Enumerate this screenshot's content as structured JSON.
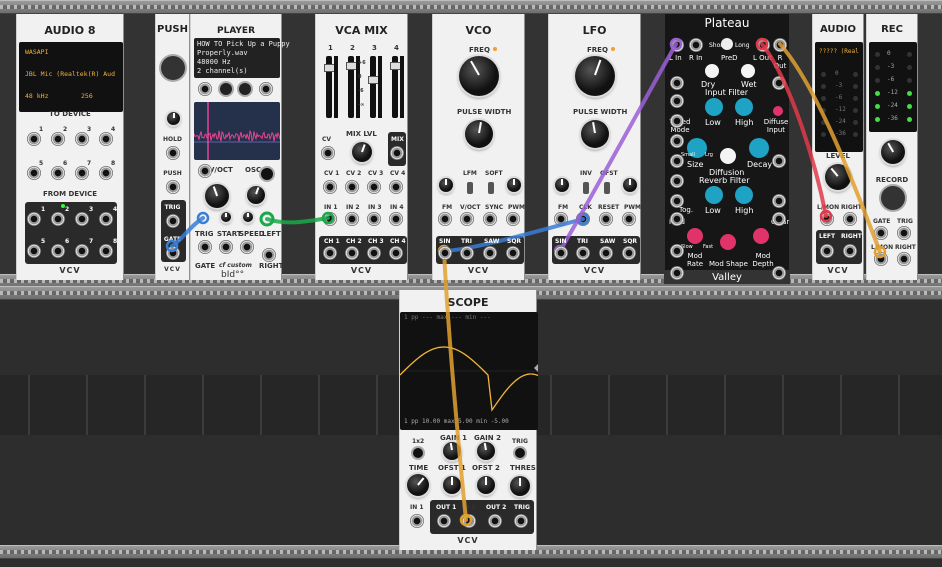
{
  "audio8": {
    "title": "AUDIO 8",
    "driver": "WASAPI",
    "device": "JBL Mic (Realtek(R) Aud",
    "rate": "48 kHz",
    "block": "256",
    "to_device": "TO DEVICE",
    "from_device": "FROM DEVICE",
    "brand": "VCV",
    "jacks_to": [
      "1",
      "2",
      "3",
      "4",
      "5",
      "6",
      "7",
      "8"
    ],
    "jacks_from": [
      "1",
      "2",
      "3",
      "4",
      "5",
      "6",
      "7",
      "8"
    ]
  },
  "push": {
    "title": "PUSH",
    "hold": "HOLD",
    "push": "PUSH",
    "trig": "TRIG",
    "gate": "GATE",
    "brand": "VCV"
  },
  "player": {
    "title": "PLAYER",
    "file_lines": [
      "HOW TO Pick Up a Puppy",
      "Properly.wav",
      "48000 Hz",
      "2 channel(s)"
    ],
    "voct": "V/OCT",
    "osc": "OSC.",
    "trig": "TRIG",
    "start": "START",
    "speed": "SPEED",
    "left": "LEFT",
    "gate": "GATE",
    "brand": "cf custom",
    "brand2": "bId°°",
    "right": "RIGHT"
  },
  "vcamix": {
    "title": "VCA MIX",
    "channels": [
      "1",
      "2",
      "3",
      "4"
    ],
    "mix_lvl": "MIX LVL",
    "mix": "MIX",
    "cv": "CV",
    "cv_labels": [
      "CV 1",
      "CV 2",
      "CV 3",
      "CV 4"
    ],
    "in_labels": [
      "IN 1",
      "IN 2",
      "IN 3",
      "IN 4"
    ],
    "ch_labels": [
      "CH 1",
      "CH 2",
      "CH 3",
      "CH 4"
    ],
    "brand": "VCV",
    "scale": [
      "+6",
      "0",
      "-6",
      "-∞"
    ]
  },
  "vco": {
    "title": "VCO",
    "freq": "FREQ",
    "pulse_width": "PULSE WIDTH",
    "lfm": "LFM",
    "soft": "SOFT",
    "fm": "FM",
    "voct": "V/OCT",
    "sync": "SYNC",
    "pwm": "PWM",
    "outs": [
      "SIN",
      "TRI",
      "SAW",
      "SQR"
    ],
    "brand": "VCV"
  },
  "lfo": {
    "title": "LFO",
    "freq": "FREQ",
    "pulse_width": "PULSE WIDTH",
    "inv": "INV",
    "ofst": "OFST",
    "fm": "FM",
    "clk": "CLK",
    "reset": "RESET",
    "pwm": "PWM",
    "outs": [
      "SIN",
      "TRI",
      "SAW",
      "SQR"
    ],
    "brand": "VCV"
  },
  "plateau": {
    "title": "Plateau",
    "l_in": "L In",
    "r_in": "R In",
    "l_out": "L Out",
    "r_out": "R Out",
    "predelay": "PreD",
    "short": "Short",
    "long": "Long",
    "dry": "Dry",
    "wet": "Wet",
    "input_filter": "Input Filter",
    "tuned_mode": "Tuned Mode",
    "low": "Low",
    "high": "High",
    "diffuse_input": "Diffuse Input",
    "size": "Size",
    "decay": "Decay",
    "small": "Small",
    "large": "Lrg",
    "diffusion": "Diffusion",
    "reverb_filter": "Reverb Filter",
    "tog": "Tog.",
    "hold": "Hold",
    "clear": "Clear",
    "mod_rate": "Mod Rate",
    "mod_shape": "Mod Shape",
    "mod_depth": "Mod Depth",
    "slow": "Slow",
    "fast": "Fast",
    "footer": "Valley"
  },
  "audio2": {
    "title": "AUDIO",
    "device": "????? (Real",
    "level": "LEVEL",
    "mon": "L/MON",
    "right": "RIGHT",
    "left": "LEFT",
    "brand": "VCV",
    "db_scale": [
      "0",
      "-3",
      "-6",
      "-12",
      "-24",
      "-36"
    ]
  },
  "rec": {
    "title": "REC",
    "db_scale": [
      "0",
      "-3",
      "-6",
      "-12",
      "-24",
      "-36"
    ],
    "record": "RECORD",
    "gate": "GATE",
    "trig": "TRIG",
    "mon": "L/MON",
    "right": "RIGHT"
  },
  "scope": {
    "title": "SCOPE",
    "top_readout": "1  pp  ---  max  ---  min  ---",
    "bottom_readout": "1  pp  10.00  max  5.00  min  -5.00",
    "x2": "1x2",
    "gain1": "GAIN 1",
    "gain2": "GAIN 2",
    "trig": "TRIG",
    "time": "TIME",
    "ofst1": "OFST 1",
    "ofst2": "OFST 2",
    "thres": "THRES",
    "in1": "IN 1",
    "out1": "OUT 1",
    "in2": "IN 2",
    "out2": "OUT 2",
    "trig2": "TRIG",
    "brand": "VCV"
  },
  "colors": {
    "cable_blue": "#3a7ed6",
    "cable_green": "#1aa84a",
    "cable_red": "#e23a4a",
    "cable_purple": "#9b5fd6",
    "cable_yellow": "#e0a030",
    "scope_trace": "#f0b43a",
    "plateau_bg": "#161616",
    "plateau_cyan": "#1fa3c4",
    "plateau_pink": "#e0336a"
  }
}
